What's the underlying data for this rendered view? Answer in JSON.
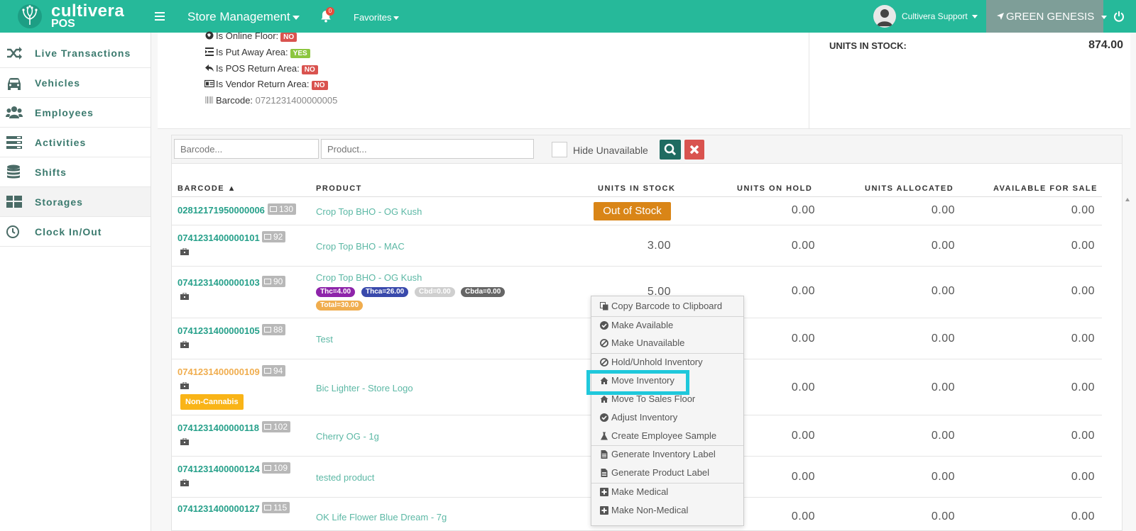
{
  "header": {
    "brand_name": "cultivera",
    "brand_sub": "POS",
    "app_menu": "Store Management",
    "notification_count": "0",
    "favorites": "Favorites",
    "user_name": "Cultivera Support",
    "store_name": "GREEN GENESIS",
    "colors": {
      "bar": "#26b99a",
      "store_selector": "#7e9e98"
    }
  },
  "sidebar": {
    "items": [
      {
        "label": "Live Transactions",
        "icon": "shuffle-icon"
      },
      {
        "label": "Vehicles",
        "icon": "car-icon"
      },
      {
        "label": "Employees",
        "icon": "users-icon"
      },
      {
        "label": "Activities",
        "icon": "server-icon"
      },
      {
        "label": "Shifts",
        "icon": "database-icon"
      },
      {
        "label": "Storages",
        "icon": "grid-icon",
        "active": true
      },
      {
        "label": "Clock In/Out",
        "icon": "clock-icon"
      }
    ]
  },
  "storage_info": {
    "online_floor": {
      "label": "Is Online Floor:",
      "value": "NO"
    },
    "put_away": {
      "label": "Is Put Away Area:",
      "value": "YES"
    },
    "pos_return": {
      "label": "Is POS Return Area:",
      "value": "NO"
    },
    "vendor_return": {
      "label": "Is Vendor Return Area:",
      "value": "NO"
    },
    "barcode": {
      "label": "Barcode:",
      "value": "0721231400000005"
    },
    "units_in_stock_label": "UNITS IN STOCK:",
    "units_in_stock_value": "874.00"
  },
  "filters": {
    "barcode_placeholder": "Barcode...",
    "product_placeholder": "Product...",
    "hide_unavailable": "Hide Unavailable"
  },
  "table": {
    "columns": [
      "BARCODE ▲",
      "PRODUCT",
      "UNITS IN STOCK",
      "UNITS ON HOLD",
      "UNITS ALLOCATED",
      "AVAILABLE FOR SALE"
    ],
    "rows": [
      {
        "barcode": "02812171950000006",
        "count": "130",
        "product": "Crop Top BHO - OG Kush",
        "stock": "Out of Stock",
        "hold": "0.00",
        "allocated": "0.00",
        "available": "0.00"
      },
      {
        "barcode": "0741231400000101",
        "count": "92",
        "product": "Crop Top BHO - MAC",
        "stock": "3.00",
        "hold": "0.00",
        "allocated": "0.00",
        "available": "0.00"
      },
      {
        "barcode": "0741231400000103",
        "count": "90",
        "product": "Crop Top BHO - OG Kush",
        "stock": "5.00",
        "hold": "0.00",
        "allocated": "0.00",
        "available": "0.00",
        "potency": [
          "Thc=4.00",
          "Thca=26.00",
          "Cbd=0.00",
          "Cbda=0.00",
          "Total=30.00"
        ]
      },
      {
        "barcode": "0741231400000105",
        "count": "88",
        "product": "Test",
        "hold": "0.00",
        "allocated": "0.00",
        "available": "0.00"
      },
      {
        "barcode": "0741231400000109",
        "count": "94",
        "product": "Bic Lighter - Store Logo",
        "hold": "0.00",
        "allocated": "0.00",
        "available": "0.00",
        "tag": "Non-Cannabis"
      },
      {
        "barcode": "0741231400000118",
        "count": "102",
        "product": "Cherry OG - 1g",
        "hold": "0.00",
        "allocated": "0.00",
        "available": "0.00"
      },
      {
        "barcode": "0741231400000124",
        "count": "109",
        "product": "tested product",
        "hold": "0.00",
        "allocated": "0.00",
        "available": "0.00"
      },
      {
        "barcode": "0741231400000127",
        "count": "115",
        "product": "OK Life Flower Blue Dream - 7g",
        "hold": "0.00",
        "allocated": "0.00",
        "available": "0.00"
      }
    ]
  },
  "context_menu": {
    "items": [
      "Copy Barcode to Clipboard",
      "Make Available",
      "Make Unavailable",
      "Hold/Unhold Inventory",
      "Move Inventory",
      "Move To Sales Floor",
      "Adjust Inventory",
      "Create Employee Sample",
      "Generate Inventory Label",
      "Generate Product Label",
      "Make Medical",
      "Make Non-Medical"
    ],
    "highlight_color": "#1fc8db"
  }
}
